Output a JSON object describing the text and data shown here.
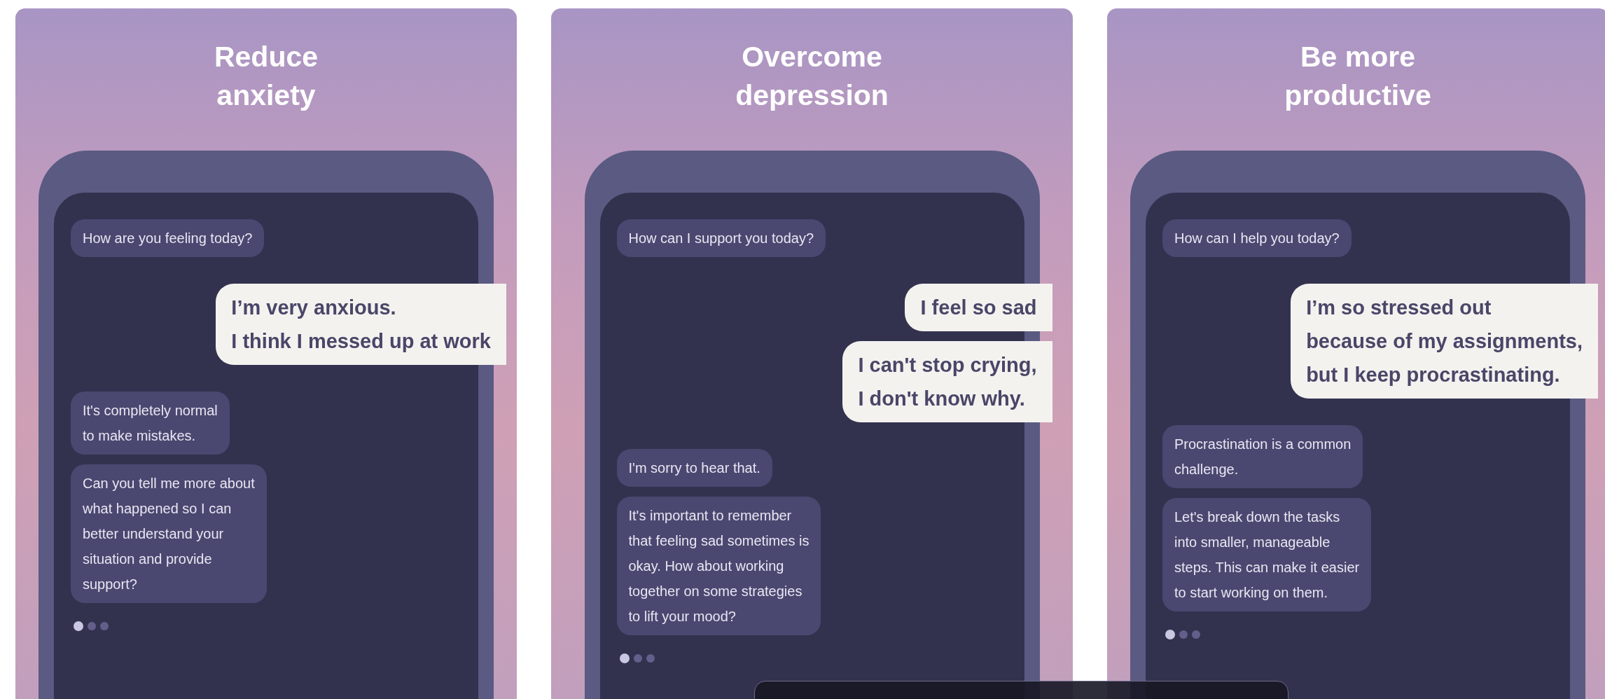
{
  "cards": [
    {
      "title": "Reduce\nanxiety",
      "messages": [
        {
          "kind": "bot",
          "text": "How are you feeling today?"
        },
        {
          "kind": "user",
          "text": "I’m very anxious.\nI think I messed up at work"
        },
        {
          "kind": "bot",
          "text": "It's completely normal\nto make mistakes."
        },
        {
          "kind": "bot",
          "text": "Can you tell me more about\nwhat happened so I can\nbetter understand your\nsituation and provide\nsupport?"
        }
      ]
    },
    {
      "title": "Overcome\ndepression",
      "messages": [
        {
          "kind": "bot",
          "text": "How can I support you today?"
        },
        {
          "kind": "user",
          "text": "I feel so sad"
        },
        {
          "kind": "user",
          "text": "I can't stop crying,\nI don't know why."
        },
        {
          "kind": "bot",
          "text": "I'm sorry to hear that."
        },
        {
          "kind": "bot",
          "text": "It's important to remember\nthat feeling sad sometimes is\nokay. How about working\ntogether on some strategies\nto lift your mood?"
        }
      ]
    },
    {
      "title": "Be more\nproductive",
      "messages": [
        {
          "kind": "bot",
          "text": "How can I help you today?"
        },
        {
          "kind": "user",
          "text": "I’m so stressed out\nbecause of my assignments,\nbut I keep procrastinating."
        },
        {
          "kind": "bot",
          "text": "Procrastination is a common\nchallenge."
        },
        {
          "kind": "bot",
          "text": "Let's break down the tasks\ninto smaller, manageable\nsteps. This can make it easier\nto start working on them."
        }
      ]
    }
  ]
}
